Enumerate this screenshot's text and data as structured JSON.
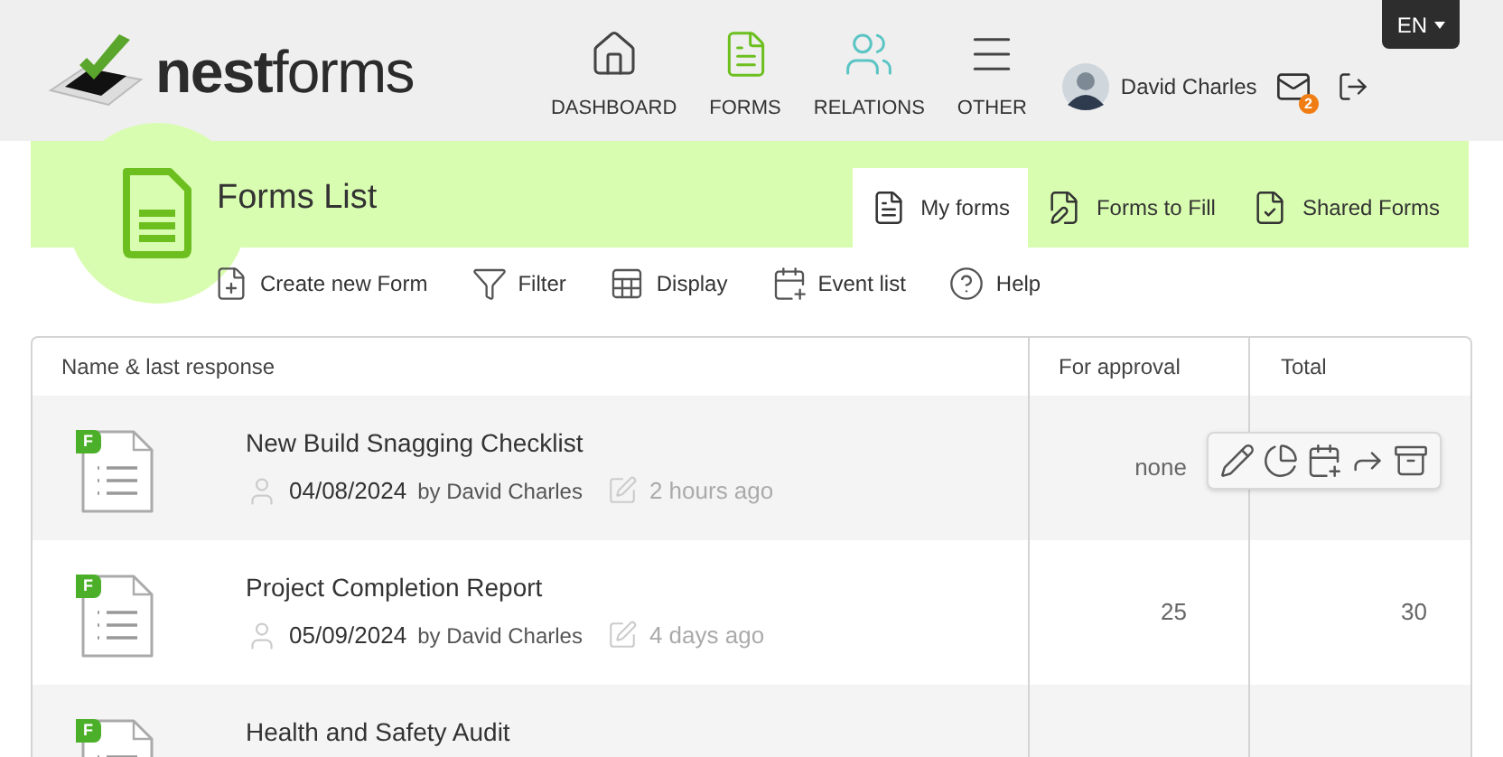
{
  "header": {
    "logo": {
      "bold": "nest",
      "light": "forms"
    },
    "nav": [
      {
        "label": "DASHBOARD",
        "selected": false
      },
      {
        "label": "FORMS",
        "selected": true
      },
      {
        "label": "RELATIONS",
        "selected": false
      },
      {
        "label": "OTHER",
        "selected": false
      }
    ],
    "language": "EN",
    "user": {
      "name": "David Charles"
    },
    "messages_badge": "2"
  },
  "page": {
    "title": "Forms List",
    "tabs": [
      {
        "label": "My forms",
        "selected": true
      },
      {
        "label": "Forms to Fill",
        "selected": false
      },
      {
        "label": "Shared Forms",
        "selected": false
      }
    ],
    "toolbar": [
      "Create new Form",
      "Filter",
      "Display",
      "Event list",
      "Help"
    ]
  },
  "table": {
    "columns": [
      "Name & last response",
      "For approval",
      "Total"
    ],
    "rows": [
      {
        "tag": "F",
        "title": "New Build Snagging Checklist",
        "date": "04/08/2024",
        "by": "by David Charles",
        "ago": "2 hours ago",
        "for_approval": "none",
        "hovered": true
      },
      {
        "tag": "F",
        "title": "Project Completion Report",
        "date": "05/09/2024",
        "by": "by David Charles",
        "ago": "4 days ago",
        "for_approval": "25",
        "total": "30",
        "hovered": false
      },
      {
        "tag": "F",
        "title": "Health and Safety Audit",
        "hovered": false
      }
    ]
  }
}
